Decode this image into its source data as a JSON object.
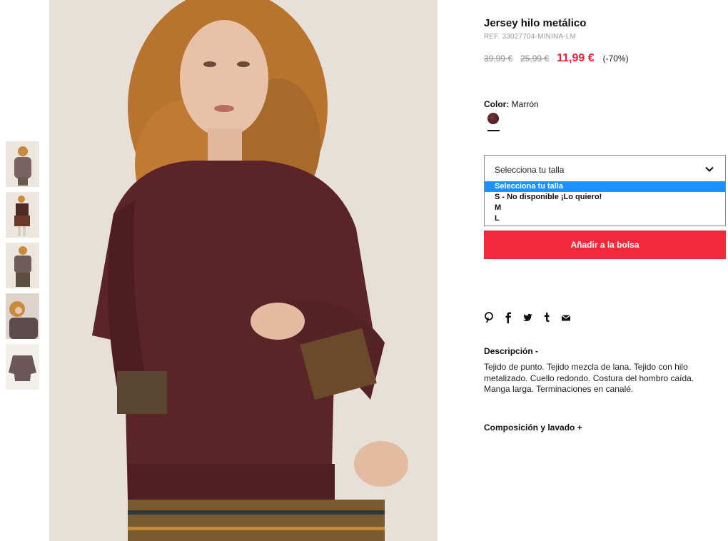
{
  "product": {
    "title": "Jersey hilo metálico",
    "ref": "REF. 33027704-MININA-LM",
    "price_original": "39,99 €",
    "price_previous": "25,99 €",
    "price_current": "11,99 €",
    "discount": "(-70%)"
  },
  "color": {
    "label": "Color:",
    "value": "Marrón",
    "swatch_hex": "#5a2428"
  },
  "size_select": {
    "selected": "Selecciona tu talla",
    "options": [
      "Selecciona tu talla",
      "S - No disponible ¡Lo quiero!",
      "M",
      "L"
    ]
  },
  "actions": {
    "add_to_bag": "Añadir a la bolsa"
  },
  "social": [
    "pinterest-icon",
    "facebook-icon",
    "twitter-icon",
    "tumblr-icon",
    "email-icon"
  ],
  "social_glyphs": [
    "℗",
    "f",
    "t",
    "t",
    "✉"
  ],
  "description": {
    "heading": "Descripción -",
    "text": "Tejido de punto. Tejido mezcla de lana. Tejido con hilo metalizado. Cuello redondo. Costura del hombro caída. Manga larga. Terminaciones en canalé."
  },
  "composition": {
    "heading": "Composición y lavado +"
  },
  "colors": {
    "accent_red": "#f2293b",
    "price_red": "#e8203a",
    "select_highlight": "#1e90ff"
  }
}
